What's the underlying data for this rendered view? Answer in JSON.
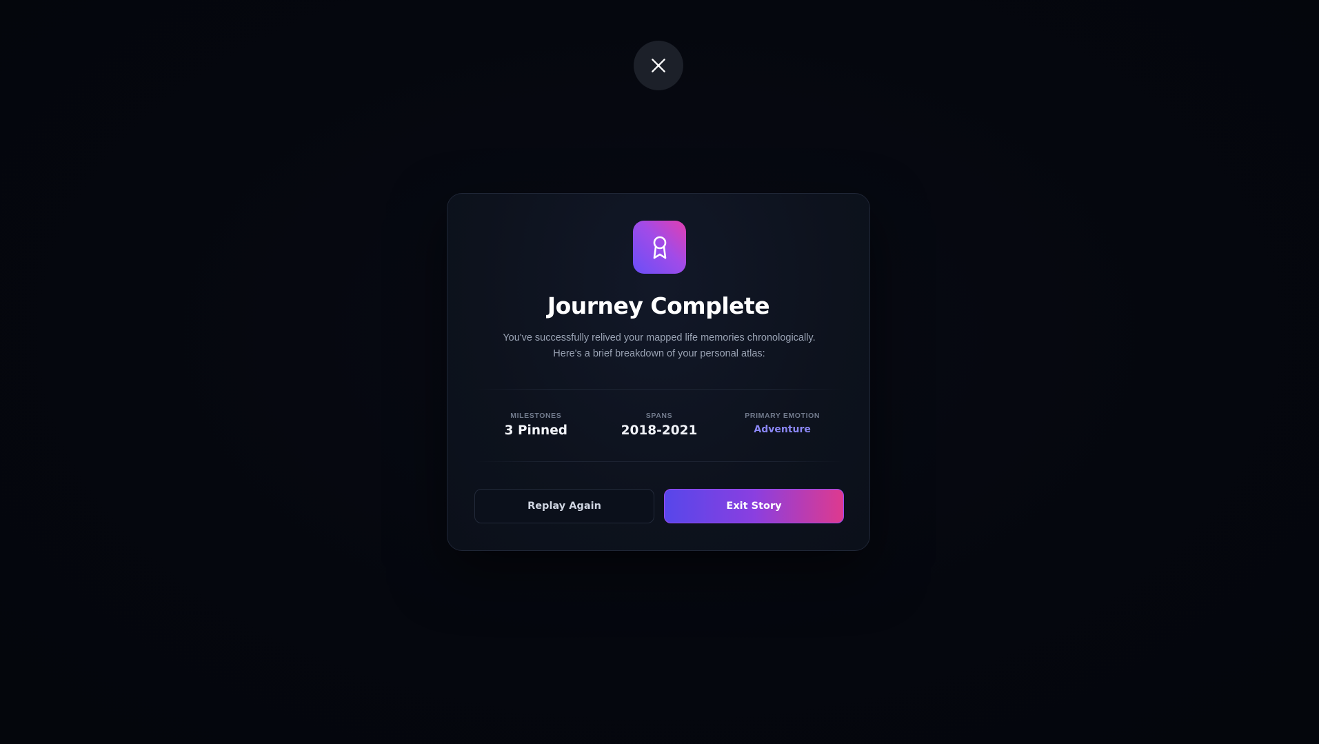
{
  "close_button": {
    "icon": "close-icon"
  },
  "dialog": {
    "badge_icon": "award-ribbon-icon",
    "title": "Journey Complete",
    "description": "You've successfully relived your mapped life memories chronologically. Here's a brief breakdown of your personal atlas:",
    "stats": [
      {
        "label": "MILESTONES",
        "value": "3 Pinned"
      },
      {
        "label": "SPANS",
        "value": "2018-2021"
      },
      {
        "label": "PRIMARY EMOTION",
        "value": "Adventure"
      }
    ],
    "replay_label": "Replay Again",
    "exit_label": "Exit Story"
  },
  "colors": {
    "background": "#05070e",
    "card": "#0d121d",
    "accent_purple": "#8b87f5",
    "gradient_start": "#5747ea",
    "gradient_end": "#de3a8e"
  }
}
